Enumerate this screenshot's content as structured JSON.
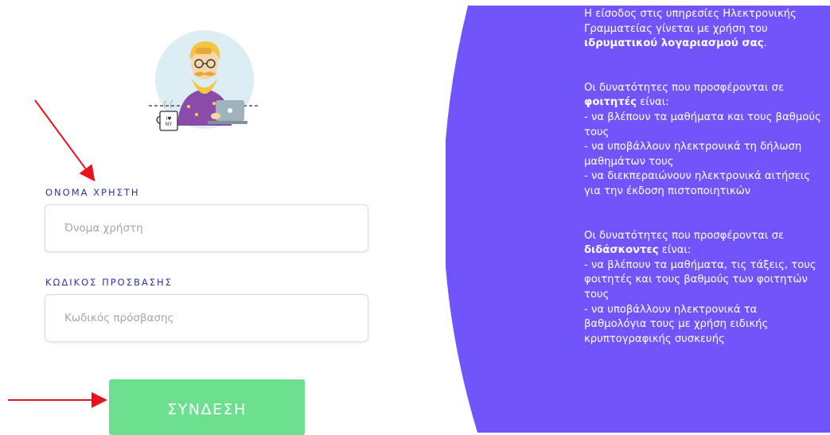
{
  "login": {
    "username_label": "ΟΝΟΜΑ ΧΡΗΣΤΗ",
    "username_placeholder": "Όνομα χρήστη",
    "password_label": "ΚΩΔΙΚΟΣ ΠΡΟΣΒΑΣΗΣ",
    "password_placeholder": "Κωδικός πρόσβασης",
    "login_button": "ΣΥΝΔΕΣΗ"
  },
  "avatar": {
    "icon": "hipster-user-laptop-illustration",
    "mug_text": "I ♥ NY"
  },
  "info": {
    "intro_prefix": "Η είσοδος στις υπηρεσίες Ηλεκτρονικής Γραμματείας γίνεται με χρήση του ",
    "intro_bold": "ιδρυματικού λογαριασμού σας",
    "intro_suffix": ".",
    "students_prefix": "Οι δυνατότητες που προσφέρονται σε ",
    "students_bold": "φοιτητές",
    "students_suffix": " είναι:",
    "students_items": [
      "- να βλέπουν τα μαθήματα και τους βαθμούς τους",
      "- να υποβάλλουν ηλεκτρονικά τη δήλωση μαθημάτων τους",
      "- να διεκπεραιώνουν ηλεκτρονικά αιτήσεις για την έκδοση πιστοποιητικών"
    ],
    "teachers_prefix": "Οι δυνατότητες που προσφέρονται σε ",
    "teachers_bold": "διδάσκοντες",
    "teachers_suffix": " είναι:",
    "teachers_items": [
      "- να βλέπουν τα μαθήματα, τις τάξεις, τους φοιτητές και τους βαθμούς των φοιτητών τους",
      "- να υποβάλλουν ηλεκτρονικά τα βαθμολόγια τους με χρήση ειδικής κρυπτογραφικής συσκευής"
    ]
  },
  "colors": {
    "panel": "#7155fb",
    "button": "#6ce08f",
    "label": "#2b35a8",
    "arrow": "#e8141b"
  }
}
